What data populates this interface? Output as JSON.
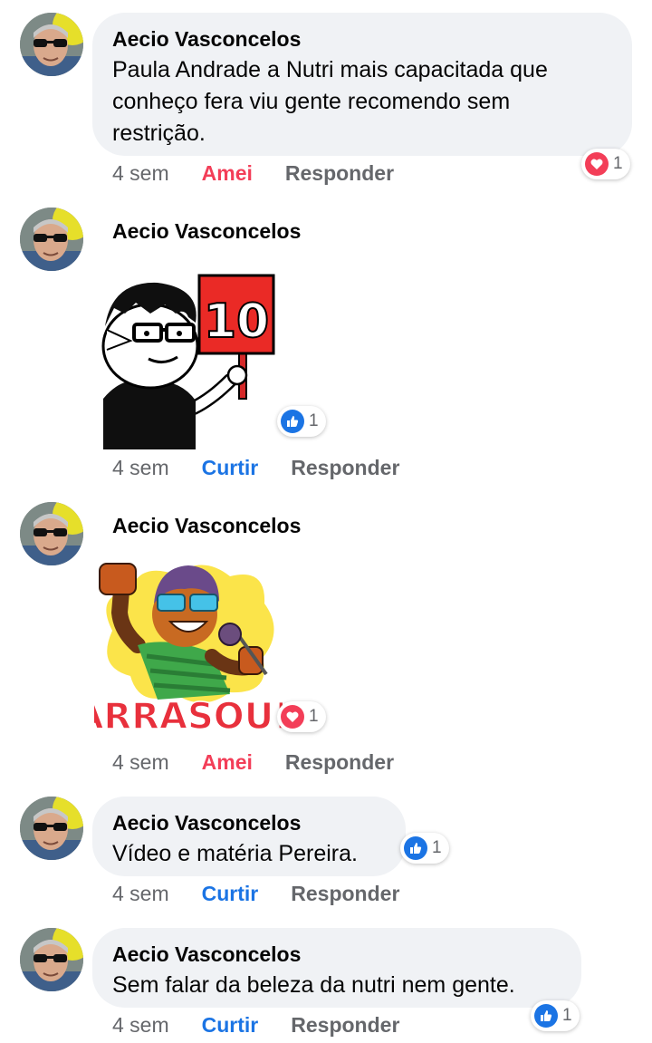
{
  "colors": {
    "love": "#f33e58",
    "like": "#1b74e4",
    "bubble": "#f0f2f5",
    "muted": "#65676b"
  },
  "comments": [
    {
      "author": "Aecio Vasconcelos",
      "text_lines": [
        "Paula Andrade a Nutri mais capacitada que",
        "conheço fera viu gente recomendo sem",
        "restrição."
      ],
      "time": "4 sem",
      "reaction_label": "Amei",
      "reply_label": "Responder",
      "badge": {
        "icon": "heart-icon",
        "count": "1"
      }
    },
    {
      "author": "Aecio Vasconcelos",
      "sticker": {
        "icon": "sticker-10-score",
        "text": "10"
      },
      "time": "4 sem",
      "reaction_label": "Curtir",
      "reply_label": "Responder",
      "badge": {
        "icon": "thumbs-up-icon",
        "count": "1"
      }
    },
    {
      "author": "Aecio Vasconcelos",
      "sticker": {
        "icon": "sticker-arrasou",
        "text": "ARRASOU!"
      },
      "time": "4 sem",
      "reaction_label": "Amei",
      "reply_label": "Responder",
      "badge": {
        "icon": "heart-icon",
        "count": "1"
      }
    },
    {
      "author": "Aecio Vasconcelos",
      "text_lines": [
        "Vídeo e matéria Pereira."
      ],
      "time": "4 sem",
      "reaction_label": "Curtir",
      "reply_label": "Responder",
      "badge": {
        "icon": "thumbs-up-icon",
        "count": "1"
      }
    },
    {
      "author": "Aecio Vasconcelos",
      "text_lines": [
        "Sem falar da beleza da nutri nem gente."
      ],
      "time": "4 sem",
      "reaction_label": "Curtir",
      "reply_label": "Responder",
      "badge": {
        "icon": "thumbs-up-icon",
        "count": "1"
      }
    }
  ]
}
